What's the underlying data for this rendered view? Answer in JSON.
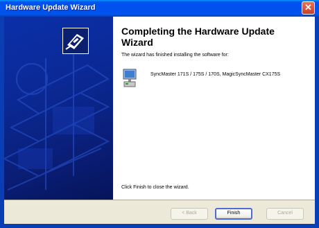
{
  "window": {
    "title": "Hardware Update Wizard",
    "close_symbol": "✕"
  },
  "wizard": {
    "heading": "Completing the Hardware Update Wizard",
    "intro": "The wizard has finished installing the software for:",
    "device_name": "SyncMaster 171S / 175S / 170S, MagicSyncMaster CX175S",
    "finish_note": "Click Finish to close the wizard.",
    "panel_icon": "hardware-wizard-icon",
    "device_icon": "monitor-icon"
  },
  "buttons": {
    "back_label": "< Back",
    "finish_label": "Finish",
    "cancel_label": "Cancel"
  },
  "colors": {
    "title_bar": "#0053EE",
    "side_panel": "#0A2FA8",
    "dialog_face": "#ECE9D8"
  }
}
